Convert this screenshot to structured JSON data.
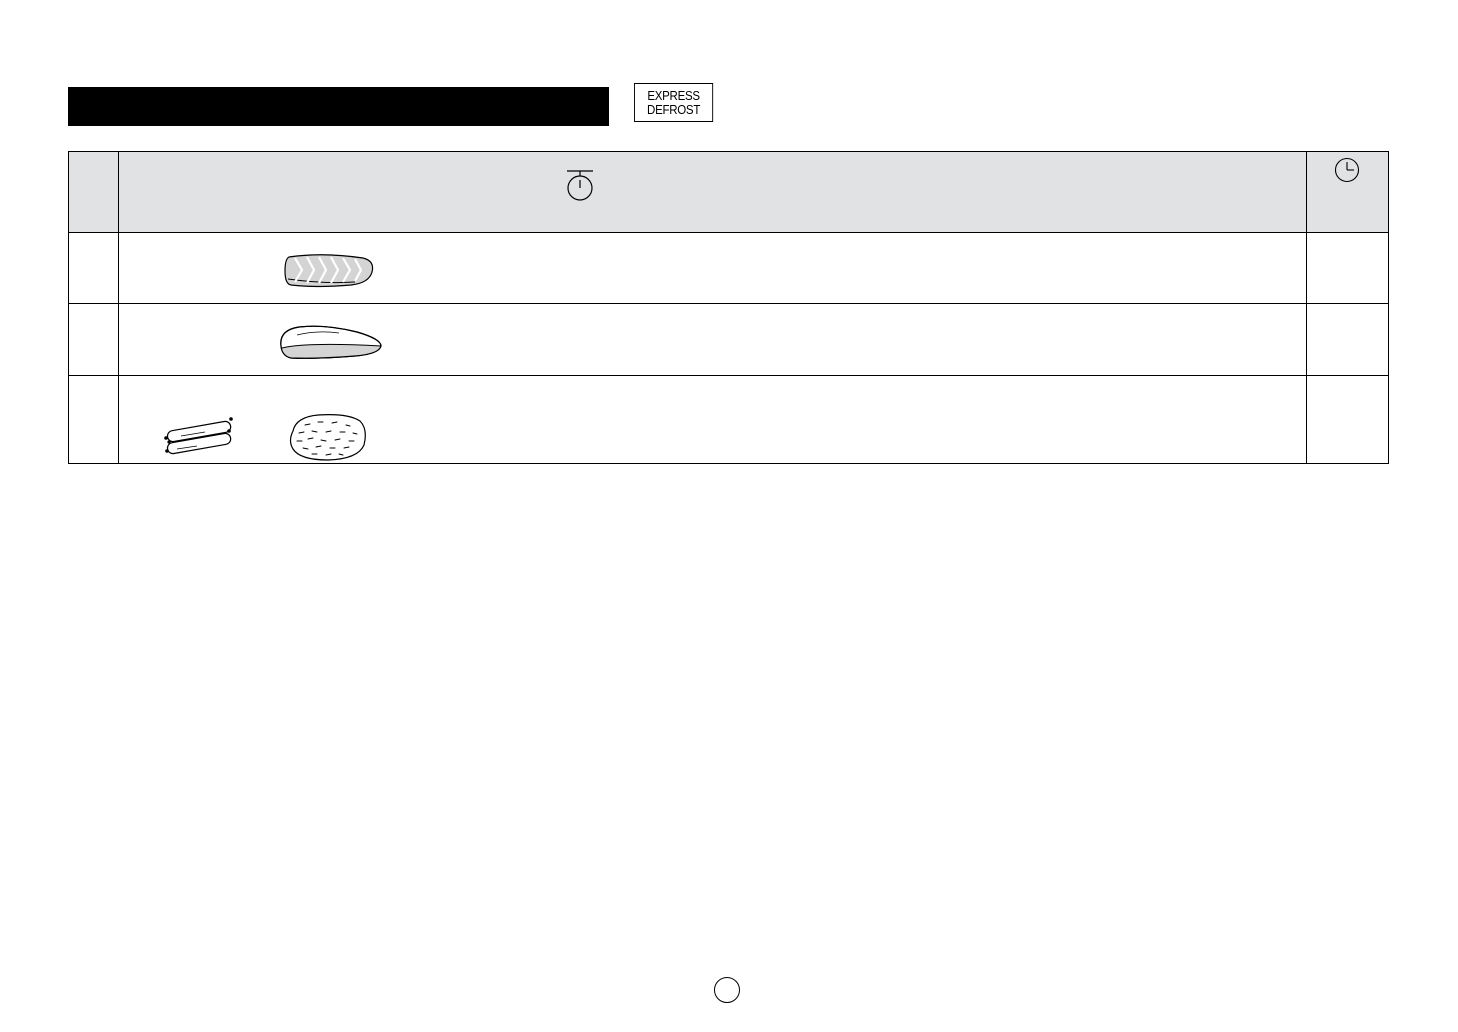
{
  "header": {
    "express_defrost_button": {
      "line1": "EXPRESS",
      "line2": "DEFROST"
    }
  },
  "table": {
    "header_icons": [
      "weight-scale-icon",
      "clock-icon"
    ],
    "rows": [
      {
        "food_icons": [
          "fish-fillet-icon"
        ]
      },
      {
        "food_icons": [
          "chicken-breast-icon"
        ]
      },
      {
        "food_icons": [
          "sausages-icon",
          "minced-meat-icon"
        ]
      }
    ]
  },
  "colors": {
    "header_bg": "#e1e2e3",
    "title_bar": "#000000",
    "food_fill": "#d4d4d4"
  }
}
